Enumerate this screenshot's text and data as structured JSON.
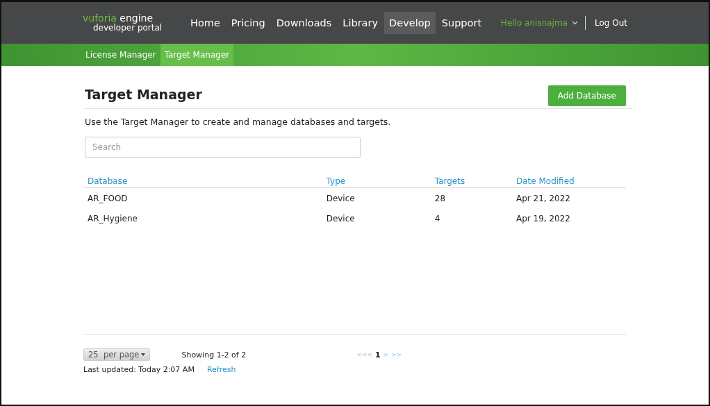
{
  "header": {
    "logo": {
      "brand": "vuforia",
      "product": "engine",
      "subtitle": "developer portal"
    },
    "nav": [
      {
        "label": "Home",
        "selected": false
      },
      {
        "label": "Pricing",
        "selected": false
      },
      {
        "label": "Downloads",
        "selected": false
      },
      {
        "label": "Library",
        "selected": false
      },
      {
        "label": "Develop",
        "selected": true
      },
      {
        "label": "Support",
        "selected": false
      }
    ],
    "user": "Hello anisnajma",
    "logout": "Log Out"
  },
  "subnav": [
    {
      "label": "License Manager",
      "selected": false
    },
    {
      "label": "Target Manager",
      "selected": true
    }
  ],
  "page": {
    "title": "Target Manager",
    "add_button": "Add Database",
    "description": "Use the Target Manager to create and manage databases and targets.",
    "search": {
      "placeholder": "Search"
    }
  },
  "table": {
    "columns": [
      "Database",
      "Type",
      "Targets",
      "Date Modified"
    ],
    "rows": [
      [
        "AR_FOOD",
        "Device",
        "28",
        "Apr 21, 2022"
      ],
      [
        "AR_Hygiene",
        "Device",
        "4",
        "Apr 19, 2022"
      ]
    ]
  },
  "footer": {
    "per_page": "25  per page",
    "showing": "Showing 1-2 of 2",
    "pager": [
      {
        "label": "<<<",
        "selected": false
      },
      {
        "label": "1",
        "selected": true
      },
      {
        "label": ">",
        "selected": false
      },
      {
        "label": ">>",
        "selected": false
      }
    ],
    "last_updated": "Last updated: Today 2:07 AM",
    "refresh": "Refresh"
  }
}
